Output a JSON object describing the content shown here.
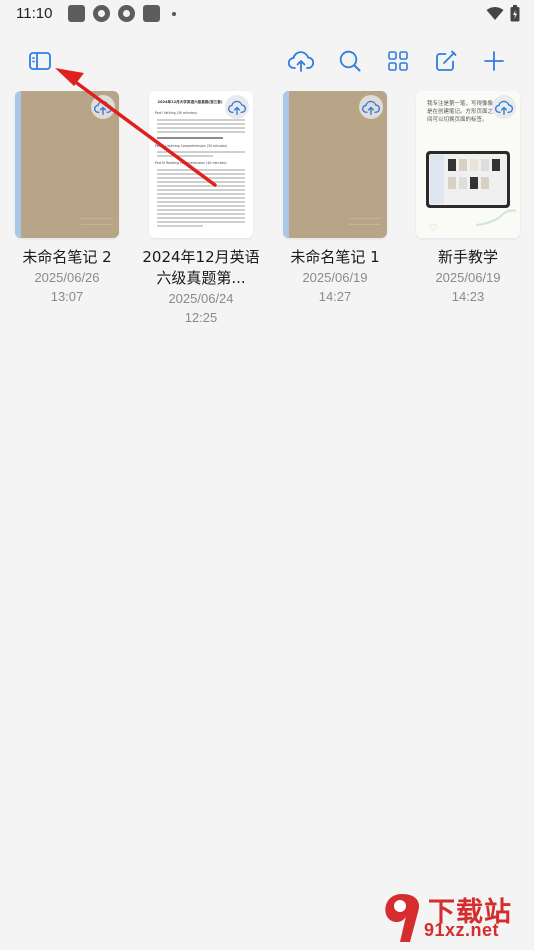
{
  "status_bar": {
    "time": "11:10"
  },
  "notes": [
    {
      "title": "未命名笔记 2",
      "date": "2025/06/26",
      "time": "13:07"
    },
    {
      "title": "2024年12月英语六级真题第...",
      "date": "2025/06/24",
      "time": "12:25"
    },
    {
      "title": "未命名笔记 1",
      "date": "2025/06/19",
      "time": "14:27"
    },
    {
      "title": "新手教学",
      "date": "2025/06/19",
      "time": "14:23"
    }
  ],
  "doc_preview": {
    "heading": "2024年12月大学英语六级真题(第三套)",
    "part1": "Part I    Writing    (30 minutes)",
    "part2": "Part II    Listening Comprehension    (30 minutes)",
    "part3": "Part III    Reading Comprehension    (40 minutes)"
  },
  "tutorial_preview": {
    "text": "我专注是第一笔，写得像像是在创建笔记。方形页面之间可以切换页面的标签。"
  },
  "watermark": {
    "brand": "下载站",
    "url": "91xz.net"
  },
  "colors": {
    "accent": "#2f7de1",
    "arrow": "#e02020",
    "kraft": "#b8a486",
    "spine": "#a9c8e8"
  }
}
